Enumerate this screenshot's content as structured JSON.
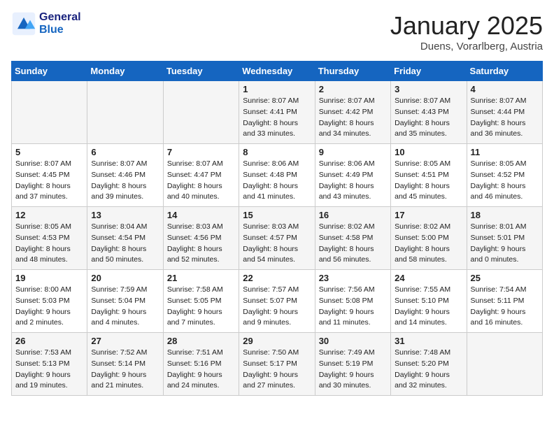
{
  "header": {
    "logo_line1": "General",
    "logo_line2": "Blue",
    "month": "January 2025",
    "location": "Duens, Vorarlberg, Austria"
  },
  "weekdays": [
    "Sunday",
    "Monday",
    "Tuesday",
    "Wednesday",
    "Thursday",
    "Friday",
    "Saturday"
  ],
  "weeks": [
    [
      {
        "day": "",
        "info": ""
      },
      {
        "day": "",
        "info": ""
      },
      {
        "day": "",
        "info": ""
      },
      {
        "day": "1",
        "info": "Sunrise: 8:07 AM\nSunset: 4:41 PM\nDaylight: 8 hours\nand 33 minutes."
      },
      {
        "day": "2",
        "info": "Sunrise: 8:07 AM\nSunset: 4:42 PM\nDaylight: 8 hours\nand 34 minutes."
      },
      {
        "day": "3",
        "info": "Sunrise: 8:07 AM\nSunset: 4:43 PM\nDaylight: 8 hours\nand 35 minutes."
      },
      {
        "day": "4",
        "info": "Sunrise: 8:07 AM\nSunset: 4:44 PM\nDaylight: 8 hours\nand 36 minutes."
      }
    ],
    [
      {
        "day": "5",
        "info": "Sunrise: 8:07 AM\nSunset: 4:45 PM\nDaylight: 8 hours\nand 37 minutes."
      },
      {
        "day": "6",
        "info": "Sunrise: 8:07 AM\nSunset: 4:46 PM\nDaylight: 8 hours\nand 39 minutes."
      },
      {
        "day": "7",
        "info": "Sunrise: 8:07 AM\nSunset: 4:47 PM\nDaylight: 8 hours\nand 40 minutes."
      },
      {
        "day": "8",
        "info": "Sunrise: 8:06 AM\nSunset: 4:48 PM\nDaylight: 8 hours\nand 41 minutes."
      },
      {
        "day": "9",
        "info": "Sunrise: 8:06 AM\nSunset: 4:49 PM\nDaylight: 8 hours\nand 43 minutes."
      },
      {
        "day": "10",
        "info": "Sunrise: 8:05 AM\nSunset: 4:51 PM\nDaylight: 8 hours\nand 45 minutes."
      },
      {
        "day": "11",
        "info": "Sunrise: 8:05 AM\nSunset: 4:52 PM\nDaylight: 8 hours\nand 46 minutes."
      }
    ],
    [
      {
        "day": "12",
        "info": "Sunrise: 8:05 AM\nSunset: 4:53 PM\nDaylight: 8 hours\nand 48 minutes."
      },
      {
        "day": "13",
        "info": "Sunrise: 8:04 AM\nSunset: 4:54 PM\nDaylight: 8 hours\nand 50 minutes."
      },
      {
        "day": "14",
        "info": "Sunrise: 8:03 AM\nSunset: 4:56 PM\nDaylight: 8 hours\nand 52 minutes."
      },
      {
        "day": "15",
        "info": "Sunrise: 8:03 AM\nSunset: 4:57 PM\nDaylight: 8 hours\nand 54 minutes."
      },
      {
        "day": "16",
        "info": "Sunrise: 8:02 AM\nSunset: 4:58 PM\nDaylight: 8 hours\nand 56 minutes."
      },
      {
        "day": "17",
        "info": "Sunrise: 8:02 AM\nSunset: 5:00 PM\nDaylight: 8 hours\nand 58 minutes."
      },
      {
        "day": "18",
        "info": "Sunrise: 8:01 AM\nSunset: 5:01 PM\nDaylight: 9 hours\nand 0 minutes."
      }
    ],
    [
      {
        "day": "19",
        "info": "Sunrise: 8:00 AM\nSunset: 5:03 PM\nDaylight: 9 hours\nand 2 minutes."
      },
      {
        "day": "20",
        "info": "Sunrise: 7:59 AM\nSunset: 5:04 PM\nDaylight: 9 hours\nand 4 minutes."
      },
      {
        "day": "21",
        "info": "Sunrise: 7:58 AM\nSunset: 5:05 PM\nDaylight: 9 hours\nand 7 minutes."
      },
      {
        "day": "22",
        "info": "Sunrise: 7:57 AM\nSunset: 5:07 PM\nDaylight: 9 hours\nand 9 minutes."
      },
      {
        "day": "23",
        "info": "Sunrise: 7:56 AM\nSunset: 5:08 PM\nDaylight: 9 hours\nand 11 minutes."
      },
      {
        "day": "24",
        "info": "Sunrise: 7:55 AM\nSunset: 5:10 PM\nDaylight: 9 hours\nand 14 minutes."
      },
      {
        "day": "25",
        "info": "Sunrise: 7:54 AM\nSunset: 5:11 PM\nDaylight: 9 hours\nand 16 minutes."
      }
    ],
    [
      {
        "day": "26",
        "info": "Sunrise: 7:53 AM\nSunset: 5:13 PM\nDaylight: 9 hours\nand 19 minutes."
      },
      {
        "day": "27",
        "info": "Sunrise: 7:52 AM\nSunset: 5:14 PM\nDaylight: 9 hours\nand 21 minutes."
      },
      {
        "day": "28",
        "info": "Sunrise: 7:51 AM\nSunset: 5:16 PM\nDaylight: 9 hours\nand 24 minutes."
      },
      {
        "day": "29",
        "info": "Sunrise: 7:50 AM\nSunset: 5:17 PM\nDaylight: 9 hours\nand 27 minutes."
      },
      {
        "day": "30",
        "info": "Sunrise: 7:49 AM\nSunset: 5:19 PM\nDaylight: 9 hours\nand 30 minutes."
      },
      {
        "day": "31",
        "info": "Sunrise: 7:48 AM\nSunset: 5:20 PM\nDaylight: 9 hours\nand 32 minutes."
      },
      {
        "day": "",
        "info": ""
      }
    ]
  ]
}
